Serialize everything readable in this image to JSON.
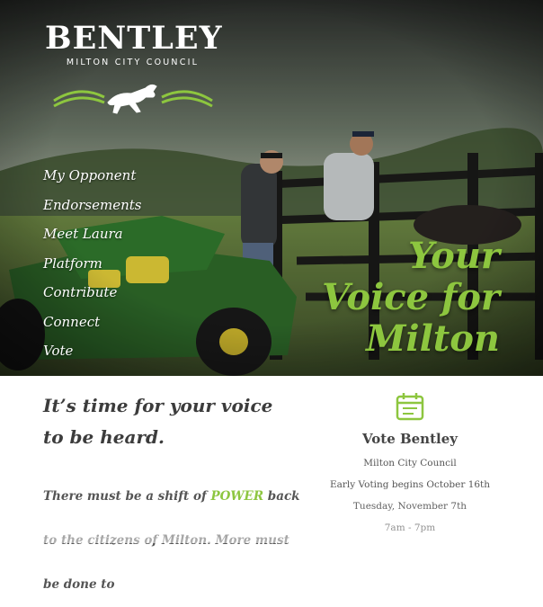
{
  "logo": {
    "title": "BENTLEY",
    "subtitle": "MILTON CITY COUNCIL"
  },
  "nav": {
    "items": [
      "My Opponent",
      "Endorsements",
      "Meet Laura",
      "Platform",
      "Contribute",
      "Connect",
      "Vote"
    ]
  },
  "hero": {
    "headline_lines": [
      "Your",
      "Voice for",
      "Milton"
    ]
  },
  "intro": {
    "lines": [
      "It’s time for your voice",
      "to be heard."
    ]
  },
  "body": {
    "before": "There must be a shift of ",
    "highlight": "POWER",
    "after": " back to the citizens of Milton. More must be done to"
  },
  "vote": {
    "icon": "calendar-icon",
    "title": "Vote Bentley",
    "lines": [
      "Milton City Council",
      "Early Voting begins October 16th",
      "Tuesday, November 7th",
      "7am - 7pm"
    ]
  },
  "colors": {
    "accent": "#8dc63f",
    "text_dark": "#3c3c3c"
  }
}
